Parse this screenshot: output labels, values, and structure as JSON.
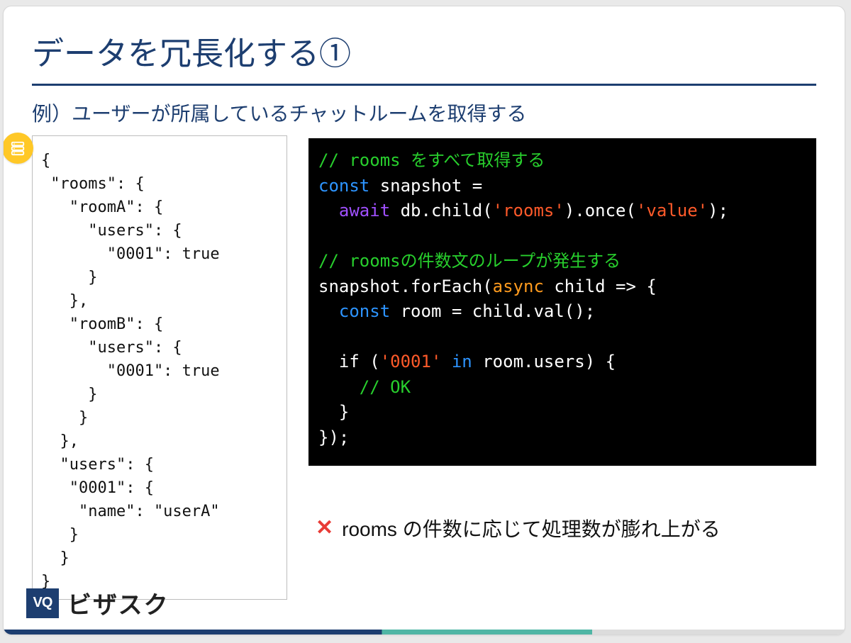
{
  "title": "データを冗長化する①",
  "subtitle": "例）ユーザーが所属しているチャットルームを取得する",
  "json_snippet": "{\n \"rooms\": {\n   \"roomA\": {\n     \"users\": {\n       \"0001\": true\n     }\n   },\n   \"roomB\": {\n     \"users\": {\n       \"0001\": true\n     }\n    }\n  },\n  \"users\": {\n   \"0001\": {\n    \"name\": \"userA\"\n   }\n  }\n}",
  "code": {
    "c01_comment": "// rooms をすべて取得する",
    "c02_const": "const",
    "c02_rest": " snapshot =",
    "c03_await": "  await",
    "c03_mid": " db.child(",
    "c03_str1": "'rooms'",
    "c03_mid2": ").once(",
    "c03_str2": "'value'",
    "c03_end": ");",
    "c05_comment": "// roomsの件数文のループが発生する",
    "c06_a": "snapshot.forEach(",
    "c06_async": "async",
    "c06_b": " child => {",
    "c07_const": "  const",
    "c07_rest": " room = child.val();",
    "c09_a": "  if (",
    "c09_str": "'0001'",
    "c09_in": " in",
    "c09_b": " room.users) {",
    "c10_ok": "    // OK",
    "c11": "  }",
    "c12": "});"
  },
  "warning": "rooms の件数に応じて処理数が膨れ上がる",
  "brand": {
    "badge": "VQ",
    "name": "ビザスク"
  },
  "icons": {
    "db": "database-icon",
    "x": "✕"
  }
}
